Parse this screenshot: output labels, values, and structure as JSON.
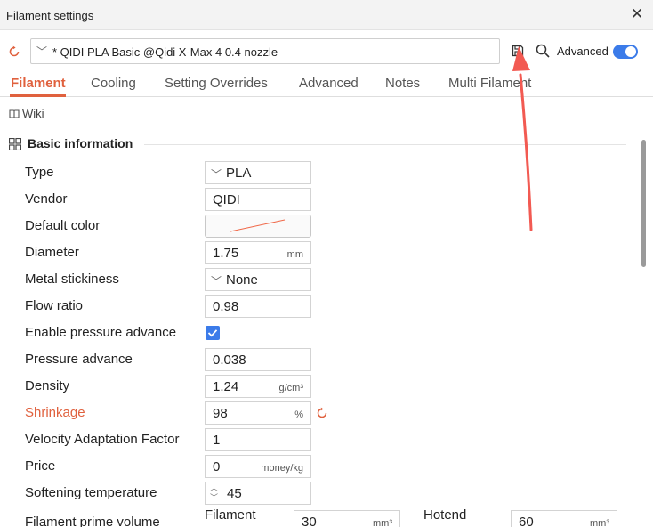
{
  "window": {
    "title": "Filament settings",
    "close_glyph": "✕"
  },
  "toolbar": {
    "preset": "* QIDI PLA Basic @Qidi X-Max 4 0.4 nozzle",
    "advanced_label": "Advanced",
    "advanced_on": true,
    "accent_color": "#3b7be9"
  },
  "tabs": [
    {
      "label": "Filament",
      "active": true
    },
    {
      "label": "Cooling",
      "active": false
    },
    {
      "label": "Setting Overrides",
      "active": false
    },
    {
      "label": "Advanced",
      "active": false
    },
    {
      "label": "Notes",
      "active": false
    },
    {
      "label": "Multi Filament",
      "active": false
    }
  ],
  "wiki": {
    "label": "Wiki",
    "icon": "book-icon"
  },
  "section": {
    "title": "Basic information",
    "icon": "grid-icon"
  },
  "fields": {
    "type": {
      "label": "Type",
      "value": "PLA"
    },
    "vendor": {
      "label": "Vendor",
      "value": "QIDI"
    },
    "default_color": {
      "label": "Default color"
    },
    "diameter": {
      "label": "Diameter",
      "value": "1.75",
      "unit": "mm"
    },
    "metal_stickiness": {
      "label": "Metal stickiness",
      "value": "None"
    },
    "flow_ratio": {
      "label": "Flow ratio",
      "value": "0.98"
    },
    "enable_pressure_advance": {
      "label": "Enable pressure advance",
      "checked": true
    },
    "pressure_advance": {
      "label": "Pressure advance",
      "value": "0.038"
    },
    "density": {
      "label": "Density",
      "value": "1.24",
      "unit": "g/cm³"
    },
    "shrinkage": {
      "label": "Shrinkage",
      "value": "98",
      "unit": "%",
      "modified": true
    },
    "velocity_adaptation_factor": {
      "label": "Velocity Adaptation Factor",
      "value": "1"
    },
    "price": {
      "label": "Price",
      "value": "0",
      "unit": "money/kg"
    },
    "softening_temperature": {
      "label": "Softening temperature",
      "value": "45"
    },
    "filament_prime_volume": {
      "label": "Filament prime volume",
      "filament_label": "Filament",
      "filament_value": "30",
      "filament_unit": "mm³",
      "hotend_label": "Hotend",
      "hotend_value": "60",
      "hotend_unit": "mm³"
    }
  },
  "colors": {
    "modified": "#e0613e",
    "annotation_arrow": "#f25a52"
  }
}
